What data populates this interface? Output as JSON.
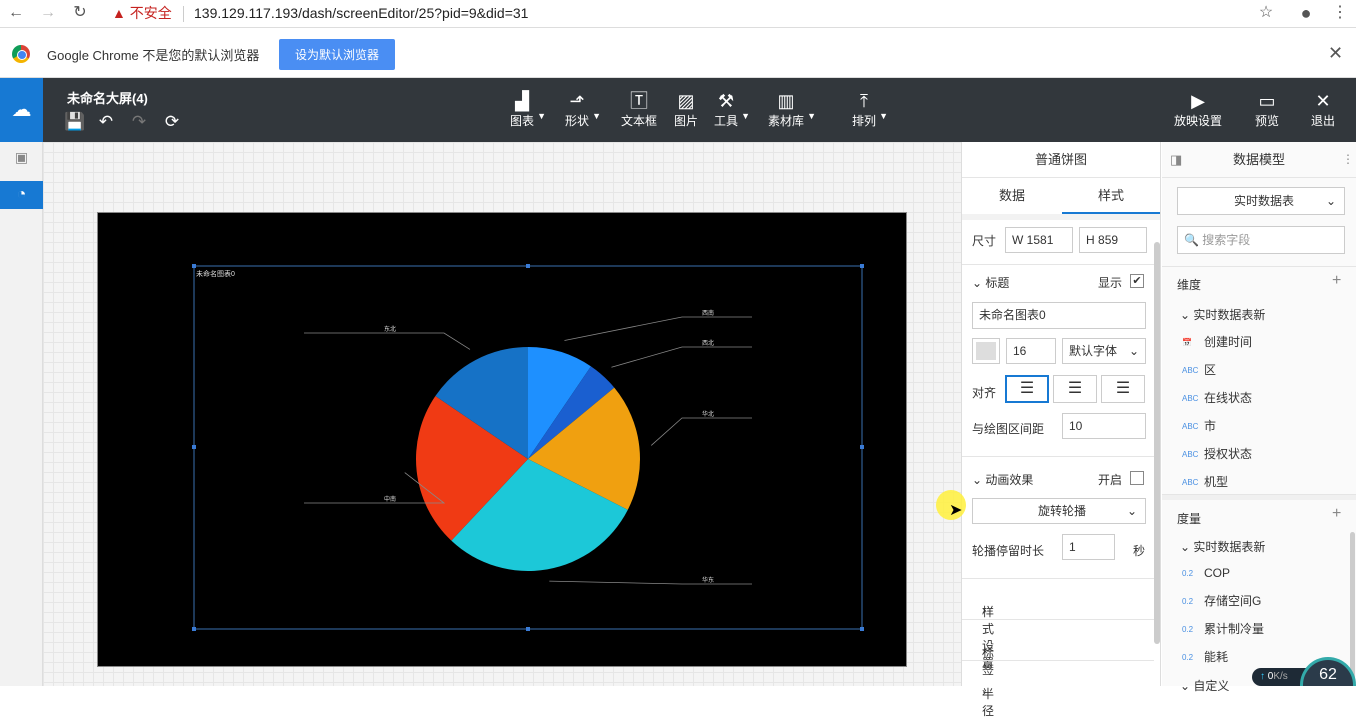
{
  "browser": {
    "insecure_label": "不安全",
    "url": "139.129.117.193/dash/screenEditor/25?pid=9&did=31"
  },
  "infobar": {
    "text": "Google Chrome 不是您的默认浏览器",
    "button": "设为默认浏览器",
    "close": "✕"
  },
  "toolbar": {
    "title": "未命名大屏(4)",
    "tools": [
      {
        "label": "图表",
        "icon": "bar-chart-icon",
        "glyph": "▟",
        "dropdown": true
      },
      {
        "label": "形状",
        "icon": "shape-icon",
        "glyph": "⬏",
        "dropdown": true
      },
      {
        "label": "文本框",
        "icon": "textbox-icon",
        "glyph": "🅃",
        "dropdown": false
      },
      {
        "label": "图片",
        "icon": "image-icon",
        "glyph": "▨",
        "dropdown": false
      },
      {
        "label": "工具",
        "icon": "hammer-icon",
        "glyph": "⚒",
        "dropdown": true
      },
      {
        "label": "素材库",
        "icon": "library-icon",
        "glyph": "▥",
        "dropdown": true
      },
      {
        "label": "排列",
        "icon": "arrange-icon",
        "glyph": "⤒",
        "dropdown": true
      }
    ],
    "right": [
      {
        "label": "放映设置",
        "icon": "play-icon",
        "glyph": "▶"
      },
      {
        "label": "预览",
        "icon": "preview-icon",
        "glyph": "▭"
      },
      {
        "label": "退出",
        "icon": "close-icon",
        "glyph": "✕"
      }
    ]
  },
  "chart": {
    "title": "未命名图表0",
    "slice_labels": [
      "西南",
      "西北",
      "华北",
      "华东",
      "中南",
      "东北"
    ]
  },
  "chart_data": {
    "type": "pie",
    "title": "未命名图表0",
    "categories": [
      "西南",
      "西北",
      "华北",
      "华东",
      "中南",
      "东北"
    ],
    "values": [
      9.5,
      4.5,
      18.5,
      29.5,
      22.5,
      15.5
    ],
    "colors": [
      "#1e90ff",
      "#1a5fd0",
      "#f0a010",
      "#1cc8d8",
      "#f03a14",
      "#1672c6"
    ]
  },
  "props": {
    "title": "普通饼图",
    "tabs": [
      "数据",
      "样式"
    ],
    "active_tab": "样式",
    "size_label": "尺寸",
    "w_label": "W",
    "w_value": "1581",
    "h_label": "H",
    "h_value": "859",
    "title_section": "标题",
    "show_label": "显示",
    "title_value": "未命名图表0",
    "font_size": "16",
    "font_family": "默认字体",
    "align_label": "对齐",
    "spacing_label": "与绘图区间距",
    "spacing_value": "10",
    "anim_section": "动画效果",
    "anim_on_label": "开启",
    "anim_mode": "旋转轮播",
    "dwell_label": "轮播停留时长",
    "dwell_value": "1",
    "dwell_unit": "秒",
    "collapsed": [
      "样式设置",
      "标签",
      "半径"
    ]
  },
  "model": {
    "title": "数据模型",
    "table_select": "实时数据表",
    "search_placeholder": "搜索字段",
    "dim_label": "维度",
    "dim_group": "实时数据表新",
    "dims": [
      {
        "type": "date",
        "name": "创建时间"
      },
      {
        "type": "ABC",
        "name": "区"
      },
      {
        "type": "ABC",
        "name": "在线状态"
      },
      {
        "type": "ABC",
        "name": "市"
      },
      {
        "type": "ABC",
        "name": "授权状态"
      },
      {
        "type": "ABC",
        "name": "机型"
      }
    ],
    "measure_label": "度量",
    "measure_group": "实时数据表新",
    "measures": [
      {
        "type": "0.2",
        "name": "COP"
      },
      {
        "type": "0.2",
        "name": "存储空间G"
      },
      {
        "type": "0.2",
        "name": "累计制冷量"
      },
      {
        "type": "0.2",
        "name": "能耗"
      }
    ],
    "more_group": "自定义",
    "net_speed": "0",
    "net_unit": "K/s",
    "gauge_value": "62"
  }
}
